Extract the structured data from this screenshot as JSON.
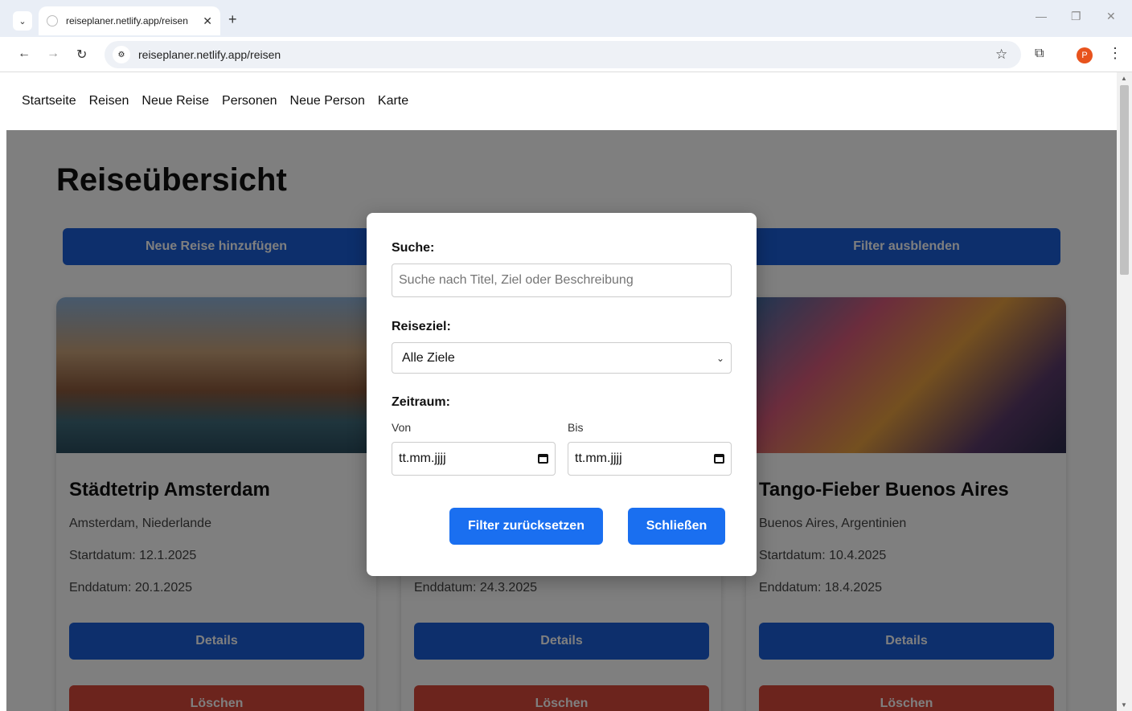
{
  "browser": {
    "tab_title": "reiseplaner.netlify.app/reisen",
    "tab_close": "✕",
    "new_tab": "+",
    "url": "reiseplaner.netlify.app/reisen",
    "profile_initial": "P"
  },
  "nav": {
    "items": [
      "Startseite",
      "Reisen",
      "Neue Reise",
      "Personen",
      "Neue Person",
      "Karte"
    ]
  },
  "page": {
    "title": "Reiseübersicht",
    "add_button": "Neue Reise hinzufügen",
    "filter_toggle_button": "Filter ausblenden"
  },
  "cards": [
    {
      "title": "Städtetrip Amsterdam",
      "location": "Amsterdam, Niederlande",
      "start": "Startdatum: 12.1.2025",
      "end": "Enddatum: 20.1.2025",
      "details": "Details",
      "delete": "Löschen"
    },
    {
      "title": "",
      "location": "",
      "start": "",
      "end": "Enddatum: 24.3.2025",
      "details": "Details",
      "delete": "Löschen"
    },
    {
      "title": "Tango-Fieber Buenos Aires",
      "location": "Buenos Aires, Argentinien",
      "start": "Startdatum: 10.4.2025",
      "end": "Enddatum: 18.4.2025",
      "details": "Details",
      "delete": "Löschen"
    }
  ],
  "modal": {
    "search_label": "Suche:",
    "search_placeholder": "Suche nach Titel, Ziel oder Beschreibung",
    "destination_label": "Reiseziel:",
    "destination_selected": "Alle Ziele",
    "period_label": "Zeitraum:",
    "from_label": "Von",
    "to_label": "Bis",
    "from_value": "tt.mm.jjjj",
    "to_value": "tt.mm.jjjj",
    "reset_button": "Filter zurücksetzen",
    "close_button": "Schließen"
  },
  "colors": {
    "primary": "#1a5fd8",
    "danger": "#d9483b",
    "modal_button": "#1a6ff0",
    "avatar": "#e8531d"
  }
}
